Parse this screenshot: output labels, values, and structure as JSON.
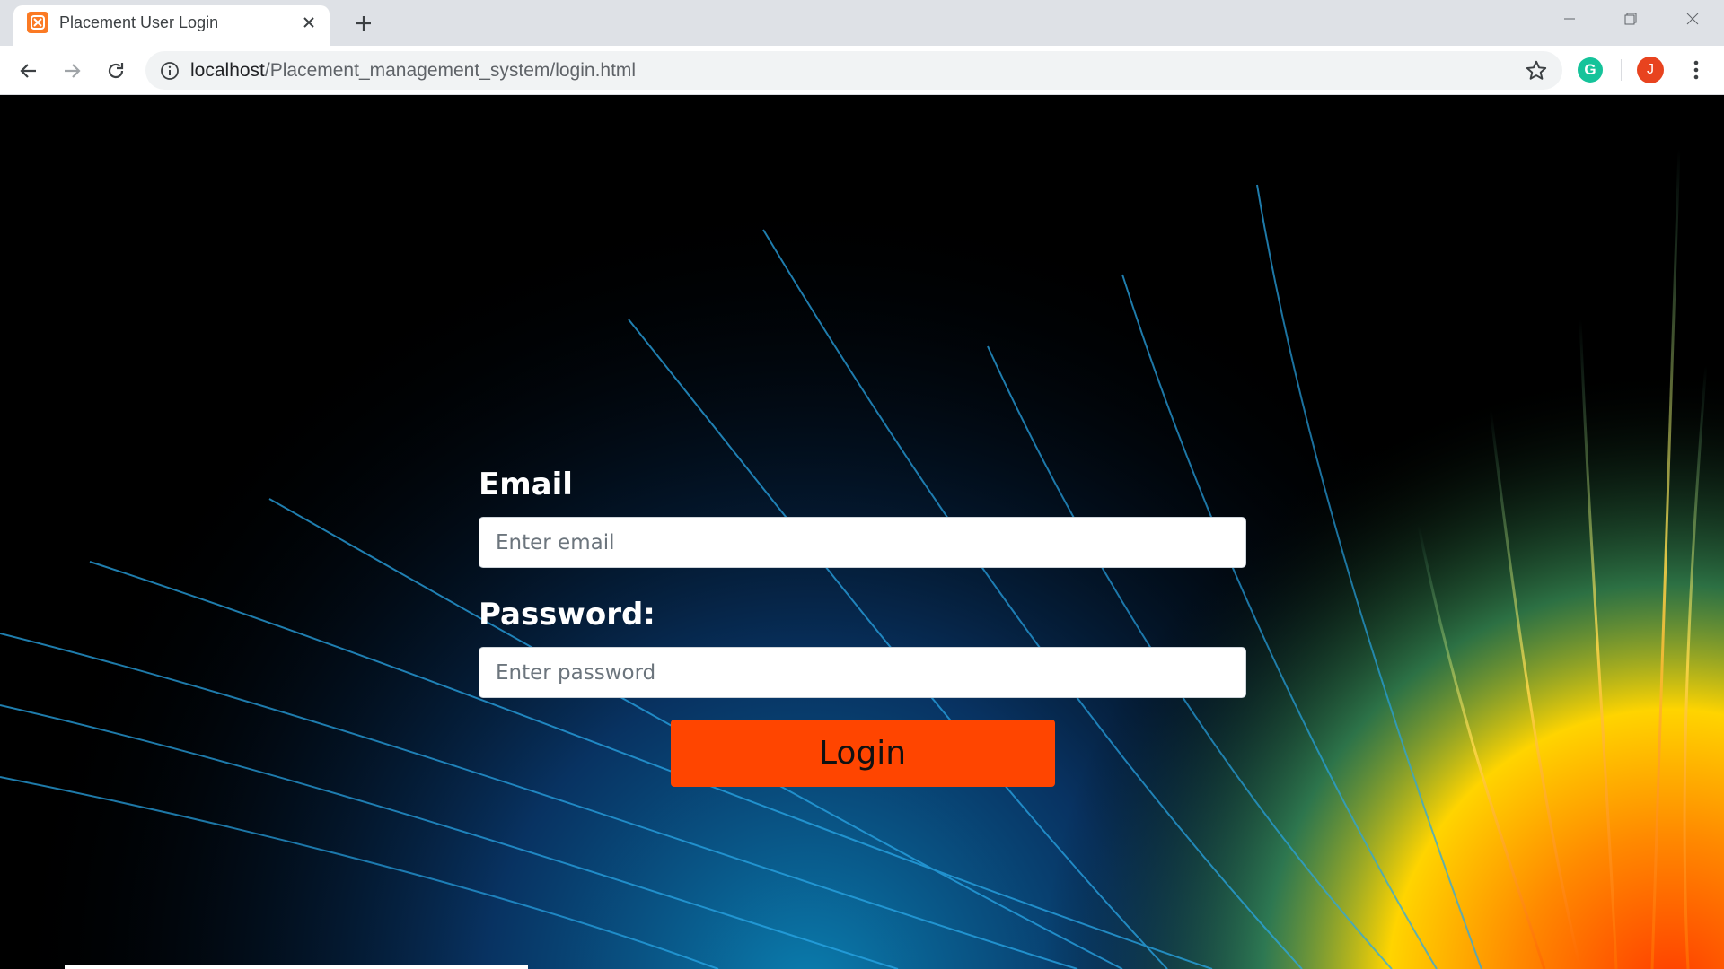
{
  "browser": {
    "tab": {
      "title": "Placement User Login",
      "favicon": "xampp-icon"
    },
    "new_tab_icon": "plus-icon",
    "address": {
      "host": "localhost",
      "path": "/Placement_management_system/login.html"
    },
    "profile_initial": "J",
    "extension_initial": "G",
    "colors": {
      "tabstrip": "#dee1e6",
      "omnibox": "#f1f3f4",
      "avatar": "#e8431f",
      "grammarly": "#15c39a"
    }
  },
  "page": {
    "email_label": "Email",
    "email_placeholder": "Enter email",
    "password_label": "Password:",
    "password_placeholder": "Enter password",
    "login_label": "Login",
    "colors": {
      "login_button": "#ff4500",
      "background": "#000000"
    }
  }
}
